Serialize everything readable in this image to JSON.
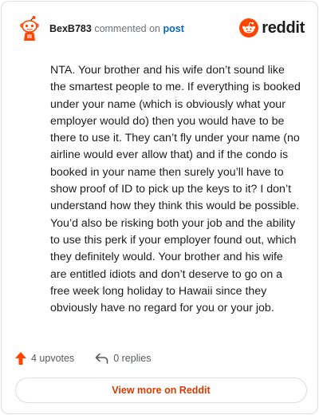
{
  "header": {
    "username": "BexB783",
    "action_text": "commented on",
    "target_link": "post",
    "brand_name": "reddit"
  },
  "comment": {
    "text": "NTA. Your brother and his wife don’t sound like the smartest people to me. If everything is booked under your name (which is obviously what your employer would do) then you would have to be there to use it. They can’t fly under your name (no airline would ever allow that) and if the condo is booked in your name then surely you’ll have to show proof of ID to pick up the keys to it? I don’t understand how they think this would be possible. You’d also be risking both your job and the ability to use this perk if your employer found out, which they definitely would. Your brother and his wife are entitled idiots and don’t deserve to go on a free week long holiday to Hawaii since they obviously have no regard for you or your job."
  },
  "footer": {
    "upvotes_label": "4 upvotes",
    "replies_label": "0 replies",
    "view_more_label": "View more on Reddit"
  },
  "icons": {
    "avatar": "snoo-avatar-icon",
    "brand": "reddit-logo-icon",
    "upvote": "upvote-arrow-icon",
    "reply": "reply-arrow-icon"
  },
  "colors": {
    "brand_orange": "#ff4500",
    "link_blue": "#0a66c2",
    "view_more_orange": "#d93a00",
    "muted_text": "#6f7378"
  }
}
